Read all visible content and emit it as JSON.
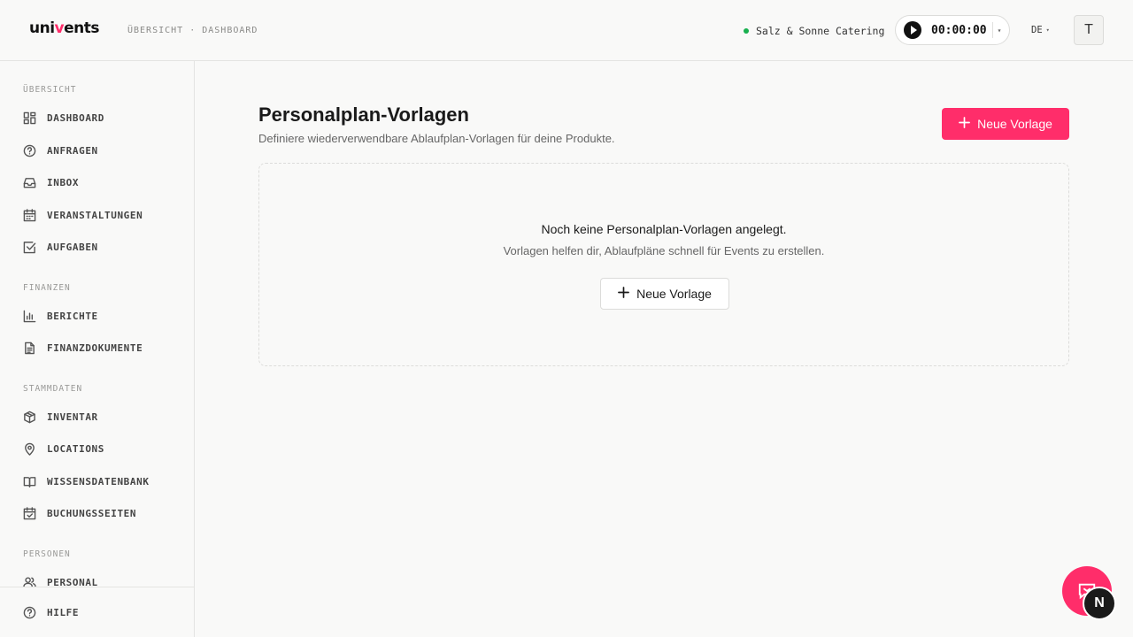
{
  "app": {
    "logo_pre": "uni",
    "logo_accent": "v",
    "logo_post": "ents"
  },
  "header": {
    "breadcrumb": "ÜBERSICHT · DASHBOARD",
    "company": "Salz & Sonne Catering",
    "timer": "00:00:00",
    "language": "DE",
    "avatar_initial": "T",
    "status_color": "#19b04f"
  },
  "sidebar": {
    "sections": {
      "overview": "ÜBERSICHT",
      "finance": "FINANZEN",
      "master": "STAMMDATEN",
      "people": "PERSONEN"
    },
    "items": {
      "dashboard": "DASHBOARD",
      "anfragen": "ANFRAGEN",
      "inbox": "INBOX",
      "veranstaltungen": "VERANSTALTUNGEN",
      "aufgaben": "AUFGABEN",
      "berichte": "BERICHTE",
      "finanzdokumente": "FINANZDOKUMENTE",
      "inventar": "INVENTAR",
      "locations": "LOCATIONS",
      "wissensdatenbank": "WISSENSDATENBANK",
      "buchungsseiten": "BUCHUNGSSEITEN",
      "personal": "PERSONAL",
      "hilfe": "HILFE"
    }
  },
  "main": {
    "title": "Personalplan-Vorlagen",
    "subtitle": "Definiere wiederverwendbare Ablaufplan-Vorlagen für deine Produkte.",
    "new_button": "Neue Vorlage",
    "empty": {
      "title": "Noch keine Personalplan-Vorlagen angelegt.",
      "subtitle": "Vorlagen helfen dir, Ablaufpläne schnell für Events zu erstellen.",
      "button": "Neue Vorlage"
    }
  },
  "floating": {
    "badge_letter": "N"
  },
  "colors": {
    "accent": "#ff2d6a"
  }
}
